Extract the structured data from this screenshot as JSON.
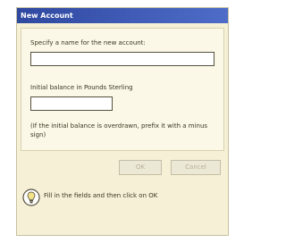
{
  "window": {
    "title": "New Account"
  },
  "form": {
    "name_label": "Specify a name for the new account:",
    "name_value": "",
    "balance_label": "Initial balance in Pounds Sterling",
    "balance_value": "",
    "note": "(If the initial balance is overdrawn, prefix it with a minus sign)"
  },
  "buttons": {
    "ok_label": "OK",
    "cancel_label": "Cancel"
  },
  "hint": {
    "icon": "lightbulb-icon",
    "text": "Fill in the fields and then click on OK"
  },
  "colors": {
    "titlebar": "#2f48a0",
    "dialog_bg": "#f6f1d6"
  }
}
